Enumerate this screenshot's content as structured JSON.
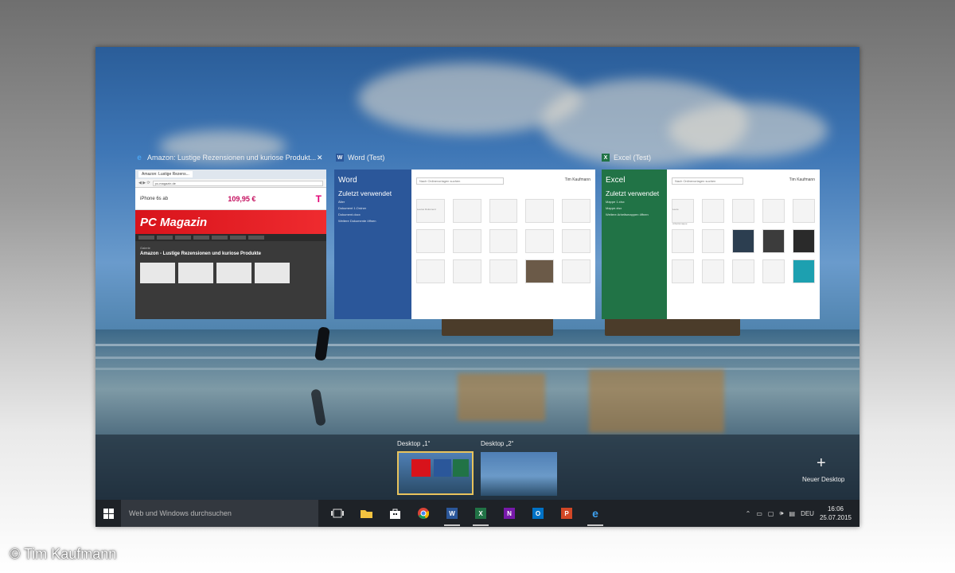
{
  "windows": [
    {
      "title": "Amazon: Lustige Rezensionen und kuriose Produkt...",
      "icon": "edge-icon",
      "close": "✕"
    },
    {
      "title": "Word (Test)",
      "icon": "word-icon"
    },
    {
      "title": "Excel (Test)",
      "icon": "excel-icon"
    }
  ],
  "browser": {
    "tab": "Amazon: Lustige Rezens...",
    "url": "pc-magazin.de",
    "ad_title": "iPhone 6s ab",
    "ad_price": "109,95 €",
    "ad_brand": "T",
    "site_name": "PC Magazin",
    "article_kicker": "Galerie",
    "article_title": "Amazon - Lustige Rezensionen und kuriose Produkte"
  },
  "word": {
    "app": "Word",
    "recent": "Zuletzt verwendet",
    "section": "Älter",
    "doc1": "Dokument 1.Ordner",
    "doc2": "Dokument.docx",
    "more": "Weitere Dokumente öffnen",
    "search_placeholder": "Nach Onlinevorlagen suchen",
    "user": "Tim Kaufmann",
    "template_label": "Leeres Dokument"
  },
  "excel": {
    "app": "Excel",
    "recent": "Zuletzt verwendet",
    "doc1": "Mappe 1.xlsx",
    "doc2": "Mappe.xlsx",
    "more": "Weitere Arbeitsmappen öffnen",
    "search_placeholder": "Nach Onlinevorlagen suchen",
    "user": "Tim Kaufmann",
    "template_label": "Leere Arbeitsmappe"
  },
  "desktops": [
    {
      "label": "Desktop „1“"
    },
    {
      "label": "Desktop „2“"
    }
  ],
  "new_desktop": {
    "plus": "+",
    "label": "Neuer Desktop"
  },
  "taskbar": {
    "search_placeholder": "Web und Windows durchsuchen",
    "language": "DEU",
    "time": "16:06",
    "date": "25.07.2015"
  },
  "credit": "© Tim Kaufmann",
  "colors": {
    "word_blue": "#2b579a",
    "excel_green": "#217346",
    "onenote_purple": "#7719aa",
    "outlook_blue": "#0072c6",
    "powerpoint_red": "#d24726",
    "edge_blue": "#1e88e5",
    "pcmagazin_red": "#d8131b"
  }
}
